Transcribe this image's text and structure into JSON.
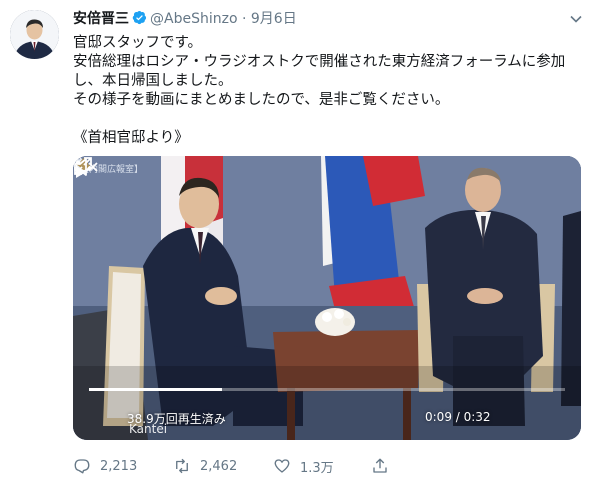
{
  "tweet": {
    "author_name": "安倍晋三",
    "handle": "@AbeShinzo",
    "separator": "·",
    "date": "9月6日",
    "lines": [
      "官邸スタッフです。",
      "安倍総理はロシア・ウラジオストクで開催された東方経済フォーラムに参加し、本日帰国しました。",
      "その様子を動画にまとめましたので、是非ご覧ください。"
    ],
    "source_line": "《首相官邸より》"
  },
  "video": {
    "watermark": "【内閣広報室】",
    "views": "38.9万回再生済み",
    "brand": "Kantei",
    "time": "0:09 / 0:32",
    "progress_fraction": 0.28
  },
  "actions": {
    "replies": "2,213",
    "retweets": "2,462",
    "likes": "1.3万"
  },
  "colors": {
    "verified_blue": "#1da1f2",
    "secondary_text": "#657786",
    "primary_text": "#14171a"
  }
}
